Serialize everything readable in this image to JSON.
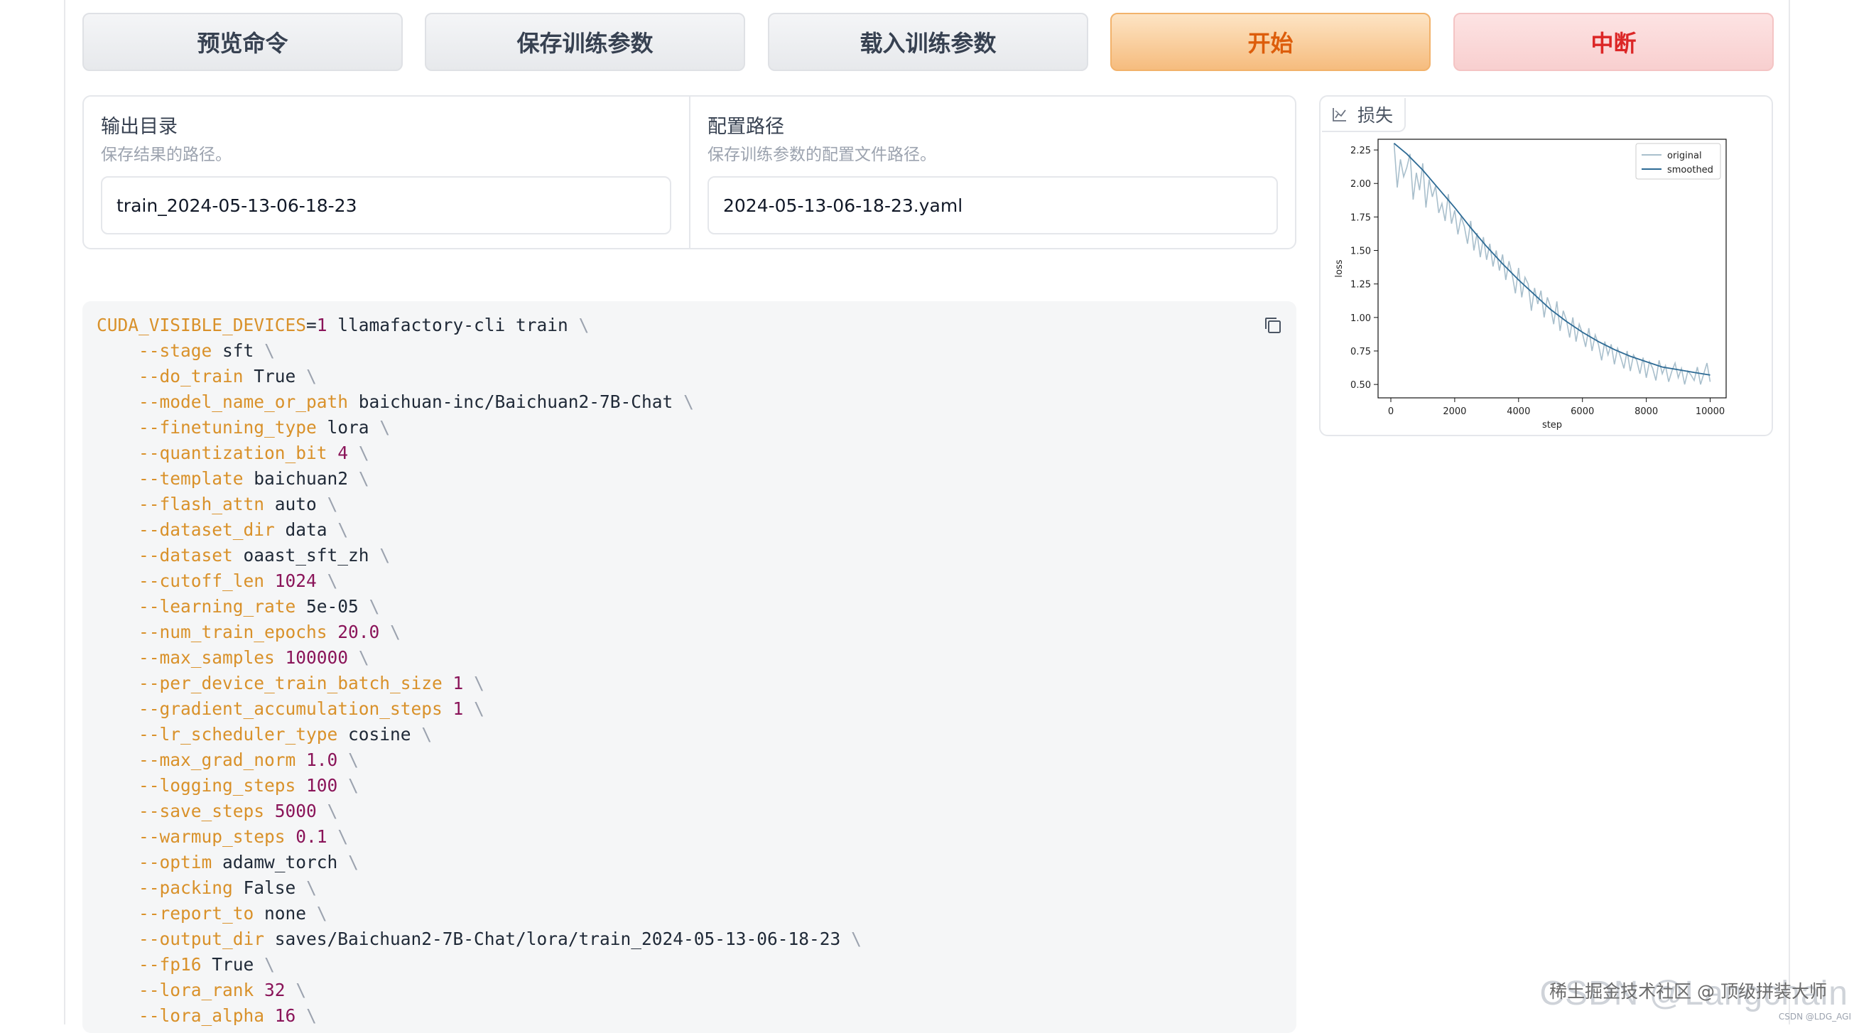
{
  "buttons": {
    "preview": "预览命令",
    "save": "保存训练参数",
    "load": "载入训练参数",
    "start": "开始",
    "abort": "中断"
  },
  "output_dir": {
    "label": "输出目录",
    "info": "保存结果的路径。",
    "value": "train_2024-05-13-06-18-23"
  },
  "config_path": {
    "label": "配置路径",
    "info": "保存训练参数的配置文件路径。",
    "value": "2024-05-13-06-18-23.yaml"
  },
  "command": {
    "head": {
      "env": "CUDA_VISIBLE_DEVICES",
      "eq": "=",
      "env_val": "1",
      "cmd": " llamafactory-cli train",
      "bs": " \\"
    },
    "args": [
      {
        "flag": "--stage",
        "value": "sft",
        "numeric": false
      },
      {
        "flag": "--do_train",
        "value": "True",
        "numeric": false
      },
      {
        "flag": "--model_name_or_path",
        "value": "baichuan-inc/Baichuan2-7B-Chat",
        "numeric": false
      },
      {
        "flag": "--finetuning_type",
        "value": "lora",
        "numeric": false
      },
      {
        "flag": "--quantization_bit",
        "value": "4",
        "numeric": true
      },
      {
        "flag": "--template",
        "value": "baichuan2",
        "numeric": false
      },
      {
        "flag": "--flash_attn",
        "value": "auto",
        "numeric": false
      },
      {
        "flag": "--dataset_dir",
        "value": "data",
        "numeric": false
      },
      {
        "flag": "--dataset",
        "value": "oaast_sft_zh",
        "numeric": false
      },
      {
        "flag": "--cutoff_len",
        "value": "1024",
        "numeric": true
      },
      {
        "flag": "--learning_rate",
        "value": "5e-05",
        "numeric": false
      },
      {
        "flag": "--num_train_epochs",
        "value": "20.0",
        "numeric": true
      },
      {
        "flag": "--max_samples",
        "value": "100000",
        "numeric": true
      },
      {
        "flag": "--per_device_train_batch_size",
        "value": "1",
        "numeric": true
      },
      {
        "flag": "--gradient_accumulation_steps",
        "value": "1",
        "numeric": true
      },
      {
        "flag": "--lr_scheduler_type",
        "value": "cosine",
        "numeric": false
      },
      {
        "flag": "--max_grad_norm",
        "value": "1.0",
        "numeric": true
      },
      {
        "flag": "--logging_steps",
        "value": "100",
        "numeric": true
      },
      {
        "flag": "--save_steps",
        "value": "5000",
        "numeric": true
      },
      {
        "flag": "--warmup_steps",
        "value": "0.1",
        "numeric": true
      },
      {
        "flag": "--optim",
        "value": "adamw_torch",
        "numeric": false
      },
      {
        "flag": "--packing",
        "value": "False",
        "numeric": false
      },
      {
        "flag": "--report_to",
        "value": "none",
        "numeric": false
      },
      {
        "flag": "--output_dir",
        "value": "saves/Baichuan2-7B-Chat/lora/train_2024-05-13-06-18-23",
        "numeric": false
      },
      {
        "flag": "--fp16",
        "value": "True",
        "numeric": false
      },
      {
        "flag": "--lora_rank",
        "value": "32",
        "numeric": true
      },
      {
        "flag": "--lora_alpha",
        "value": "16",
        "numeric": true
      }
    ]
  },
  "plot": {
    "tab_label": "损失",
    "tab_icon": "line-chart-icon"
  },
  "chart_data": {
    "type": "line",
    "xlabel": "step",
    "ylabel": "loss",
    "xlim": [
      -400,
      10500
    ],
    "ylim": [
      0.4,
      2.33
    ],
    "xticks": [
      0,
      2000,
      4000,
      6000,
      8000,
      10000
    ],
    "yticks": [
      0.5,
      0.75,
      1.0,
      1.25,
      1.5,
      1.75,
      2.0,
      2.25
    ],
    "ytick_labels": [
      "0.50",
      "0.75",
      "1.00",
      "1.25",
      "1.50",
      "1.75",
      "2.00",
      "2.25"
    ],
    "legend_position": "top-right",
    "series": [
      {
        "name": "original",
        "color": "#a9bfcc",
        "x": [
          100,
          200,
          300,
          400,
          500,
          600,
          700,
          800,
          900,
          1000,
          1100,
          1200,
          1300,
          1400,
          1500,
          1600,
          1700,
          1800,
          1900,
          2000,
          2100,
          2200,
          2300,
          2400,
          2500,
          2600,
          2700,
          2800,
          2900,
          3000,
          3100,
          3200,
          3300,
          3400,
          3500,
          3600,
          3700,
          3800,
          3900,
          4000,
          4100,
          4200,
          4300,
          4400,
          4500,
          4600,
          4700,
          4800,
          4900,
          5000,
          5100,
          5200,
          5300,
          5400,
          5500,
          5600,
          5700,
          5800,
          5900,
          6000,
          6100,
          6200,
          6300,
          6400,
          6500,
          6600,
          6700,
          6800,
          6900,
          7000,
          7100,
          7200,
          7300,
          7400,
          7500,
          7600,
          7700,
          7800,
          7900,
          8000,
          8100,
          8200,
          8300,
          8400,
          8500,
          8600,
          8700,
          8800,
          8900,
          9000,
          9100,
          9200,
          9300,
          9400,
          9500,
          9600,
          9700,
          9800,
          9900,
          10000
        ],
        "y": [
          2.3,
          1.97,
          2.18,
          2.05,
          2.12,
          2.22,
          1.88,
          2.08,
          1.95,
          2.15,
          1.82,
          2.03,
          1.9,
          1.98,
          1.78,
          1.85,
          1.72,
          1.92,
          1.7,
          1.8,
          1.62,
          1.75,
          1.68,
          1.55,
          1.72,
          1.5,
          1.63,
          1.45,
          1.6,
          1.43,
          1.55,
          1.38,
          1.5,
          1.35,
          1.47,
          1.28,
          1.42,
          1.32,
          1.18,
          1.37,
          1.15,
          1.3,
          1.25,
          1.05,
          1.22,
          1.1,
          1.2,
          1.0,
          1.15,
          1.08,
          0.95,
          1.12,
          0.9,
          1.05,
          0.98,
          0.85,
          1.0,
          0.82,
          0.95,
          0.88,
          0.78,
          0.92,
          0.75,
          0.87,
          0.8,
          0.68,
          0.82,
          0.72,
          0.8,
          0.65,
          0.77,
          0.7,
          0.62,
          0.75,
          0.6,
          0.72,
          0.68,
          0.58,
          0.7,
          0.55,
          0.67,
          0.62,
          0.53,
          0.68,
          0.58,
          0.64,
          0.52,
          0.6,
          0.66,
          0.55,
          0.62,
          0.5,
          0.6,
          0.57,
          0.53,
          0.63,
          0.5,
          0.58,
          0.66,
          0.52
        ]
      },
      {
        "name": "smoothed",
        "color": "#2e6b95",
        "x": [
          100,
          500,
          1000,
          1500,
          2000,
          2500,
          3000,
          3500,
          4000,
          4500,
          5000,
          5500,
          6000,
          6500,
          7000,
          7500,
          8000,
          8500,
          9000,
          9500,
          10000
        ],
        "y": [
          2.3,
          2.22,
          2.1,
          1.96,
          1.82,
          1.67,
          1.53,
          1.4,
          1.28,
          1.17,
          1.06,
          0.97,
          0.89,
          0.82,
          0.76,
          0.71,
          0.67,
          0.63,
          0.61,
          0.59,
          0.57
        ]
      }
    ]
  },
  "watermark": {
    "big": "CSDN @Langchain",
    "mid": "稀土掘金技术社区 @ 顶级拼装大师",
    "small": "CSDN @LDG_AGI"
  }
}
